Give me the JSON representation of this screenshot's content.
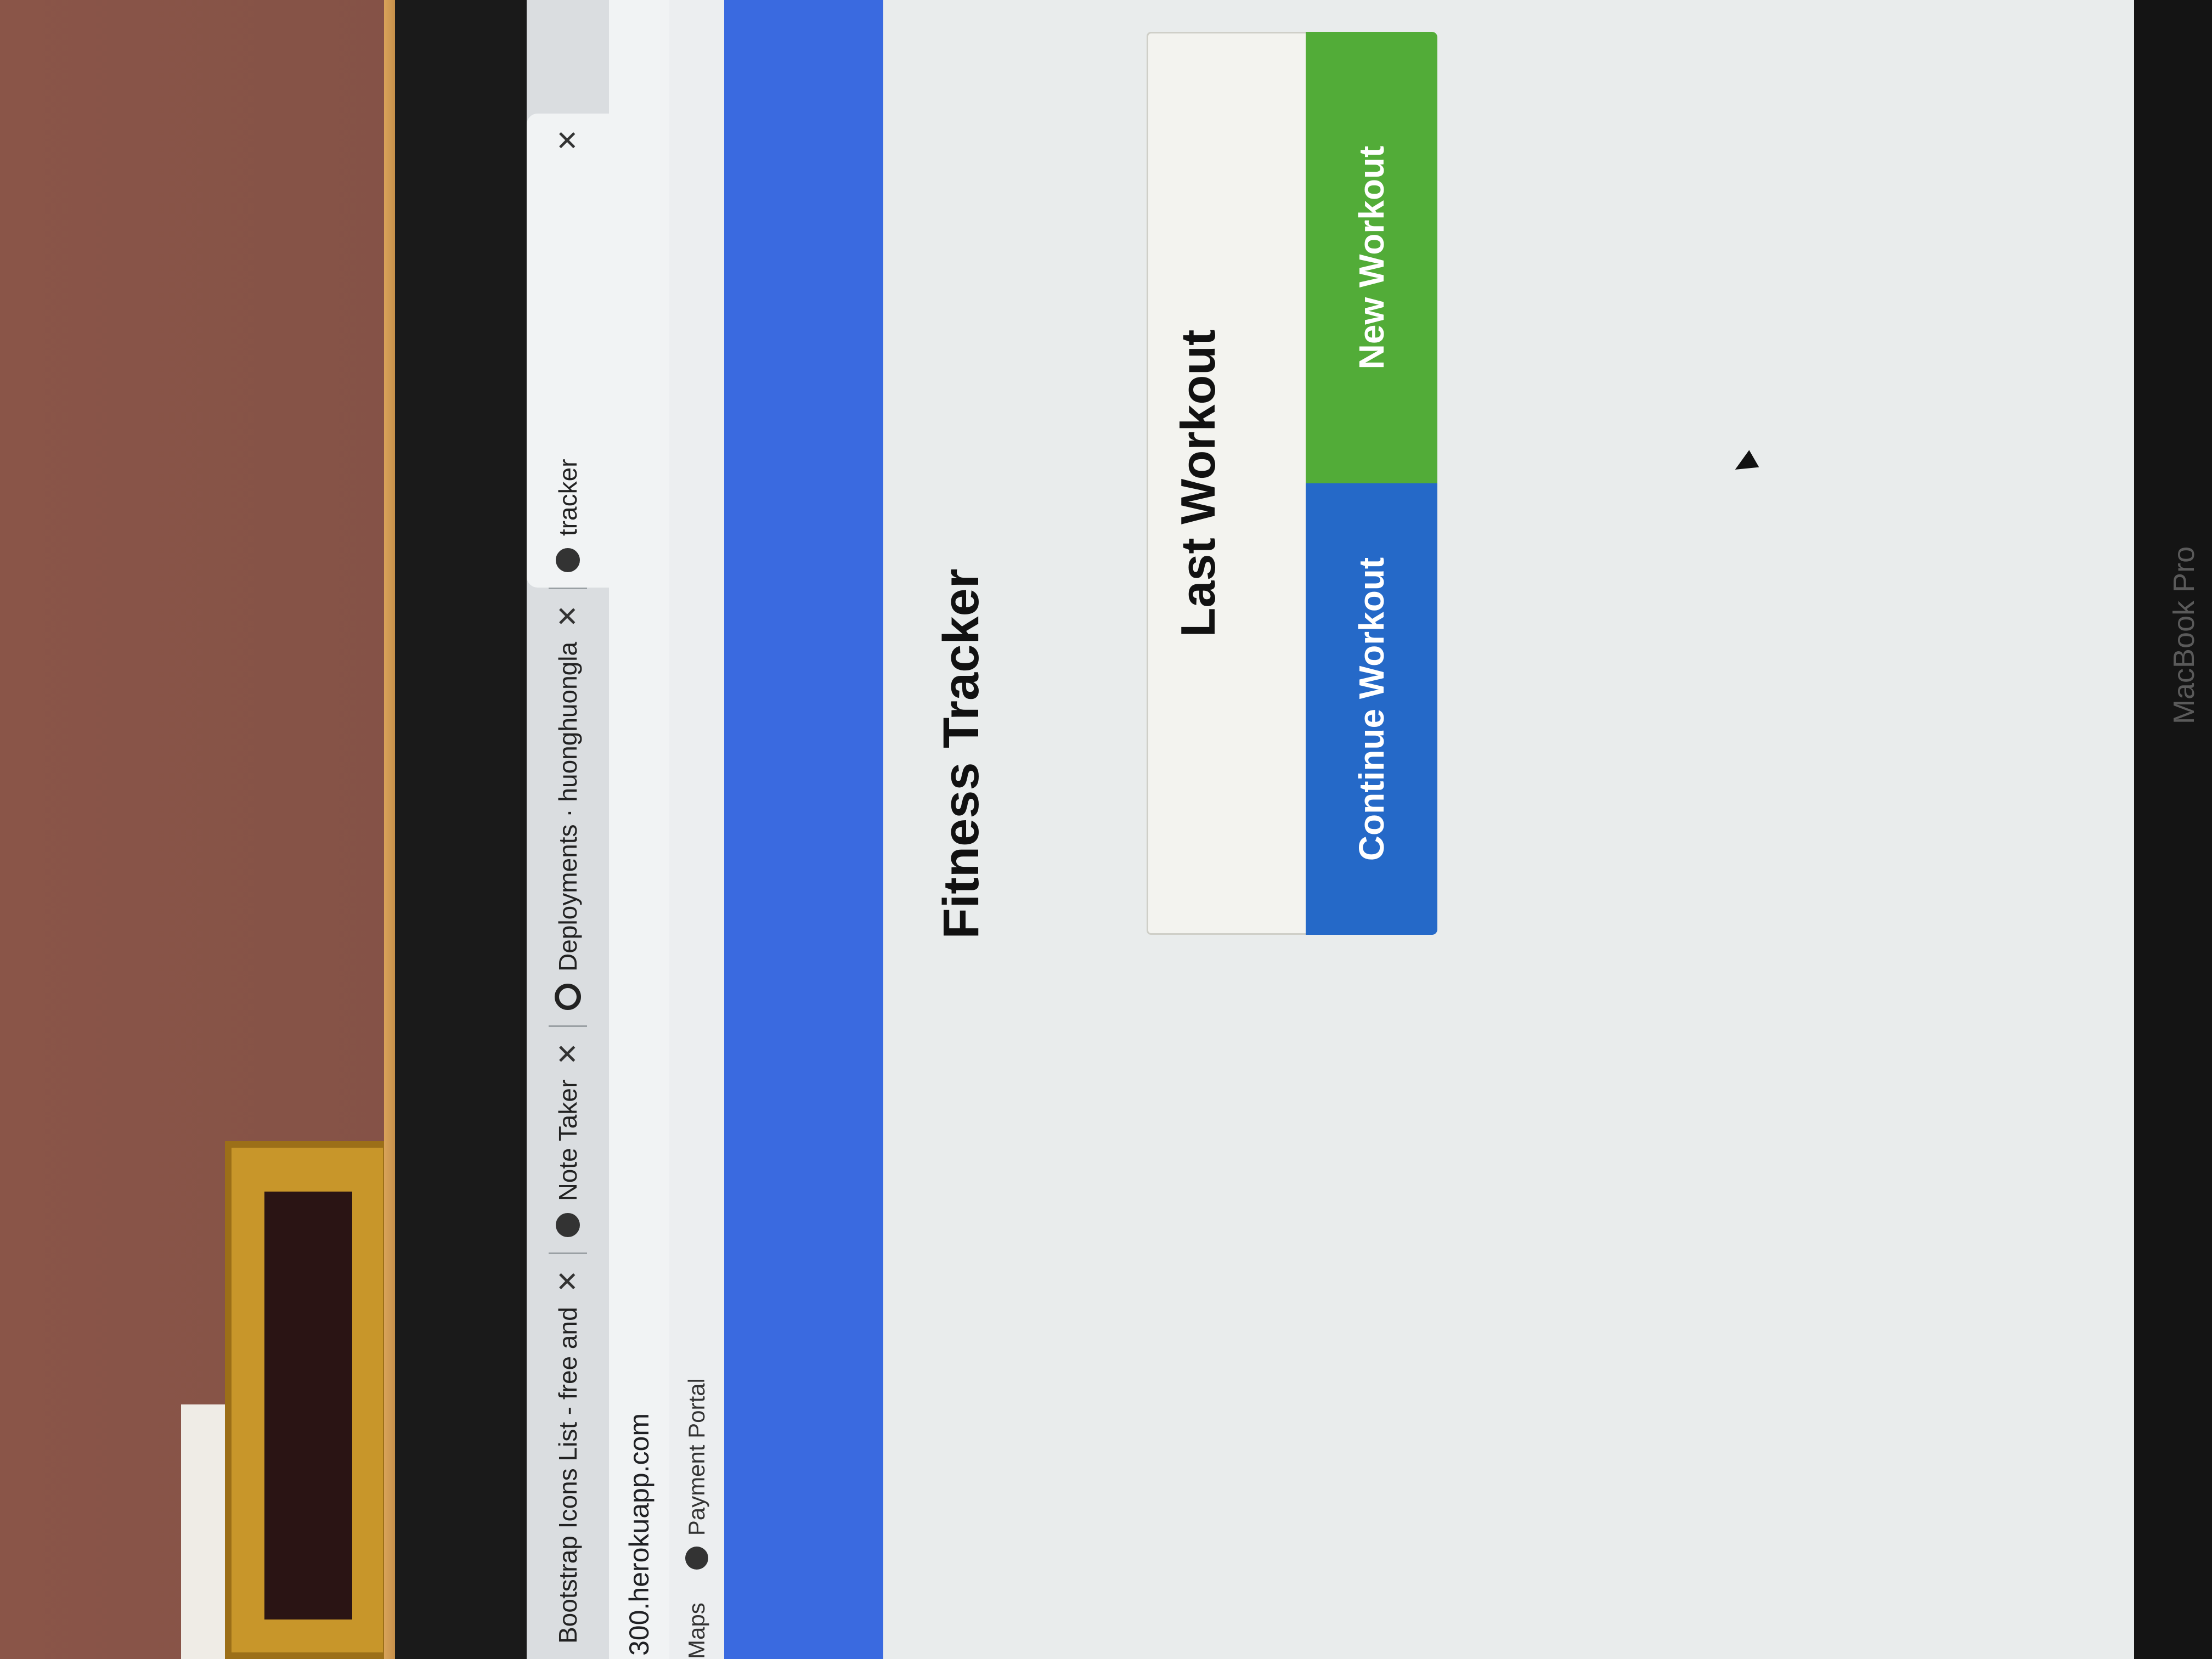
{
  "browser": {
    "tabs": [
      {
        "label": "Bootstrap Icons List - free and",
        "icon": "bootstrap-icon"
      },
      {
        "label": "Note Taker",
        "icon": "globe-icon"
      },
      {
        "label": "Deployments · huonghuongla",
        "icon": "github-icon"
      },
      {
        "label": "tracker",
        "icon": "globe-icon"
      }
    ],
    "close_glyph": "✕",
    "url": "300.herokuapp.com",
    "bookmarks": [
      {
        "label": "Maps"
      },
      {
        "label": "Payment Portal"
      }
    ]
  },
  "page": {
    "title": "Fitness Tracker",
    "card_title": "Last Workout",
    "continue_button": "Continue Workout",
    "new_button": "New Workout"
  },
  "device": {
    "brand": "MacBook Pro"
  },
  "colors": {
    "navbar": "#3a6ae0",
    "continue": "#2569c8",
    "new": "#52ac38"
  }
}
